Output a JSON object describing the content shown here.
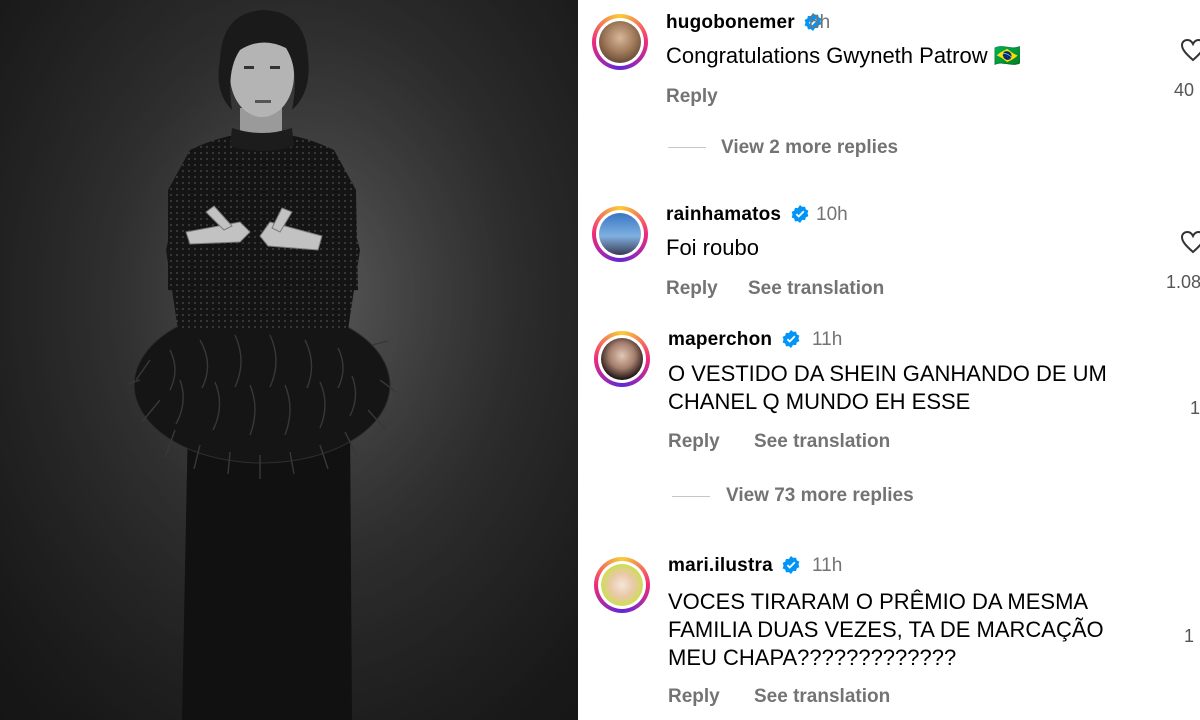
{
  "comments": [
    {
      "username": "hugobonemer",
      "time": "8h",
      "text": "Congratulations Gwyneth Patrow",
      "flag": "🇧🇷",
      "actions": [
        "Reply"
      ],
      "likes": "40",
      "more_replies": "View 2 more replies"
    },
    {
      "username": "rainhamatos",
      "time": "10h",
      "text": "Foi roubo",
      "actions": [
        "Reply",
        "See translation"
      ],
      "likes": "1.08"
    },
    {
      "username": "maperchon",
      "time": "11h",
      "text_lines": [
        "O VESTIDO DA SHEIN GANHANDO DE UM",
        "CHANEL Q MUNDO EH ESSE"
      ],
      "actions": [
        "Reply",
        "See translation"
      ],
      "likes": "1",
      "more_replies": "View 73 more replies"
    },
    {
      "username": "mari.ilustra",
      "time": "11h",
      "text_lines": [
        "VOCES TIRARAM O PRÊMIO DA MESMA",
        "FAMILIA DUAS VEZES, TA DE MARCAÇÃO",
        "MEU CHAPA?????????????"
      ],
      "actions": [
        "Reply",
        "See translation"
      ],
      "likes": "1"
    }
  ],
  "colors": {
    "verified": "#0095f6",
    "secondary_text": "#737373",
    "story_ring": [
      "#f9ce34",
      "#ee2a7b",
      "#6228d7"
    ]
  },
  "icons": {
    "verified": "verified-badge-icon",
    "like": "heart-icon"
  }
}
